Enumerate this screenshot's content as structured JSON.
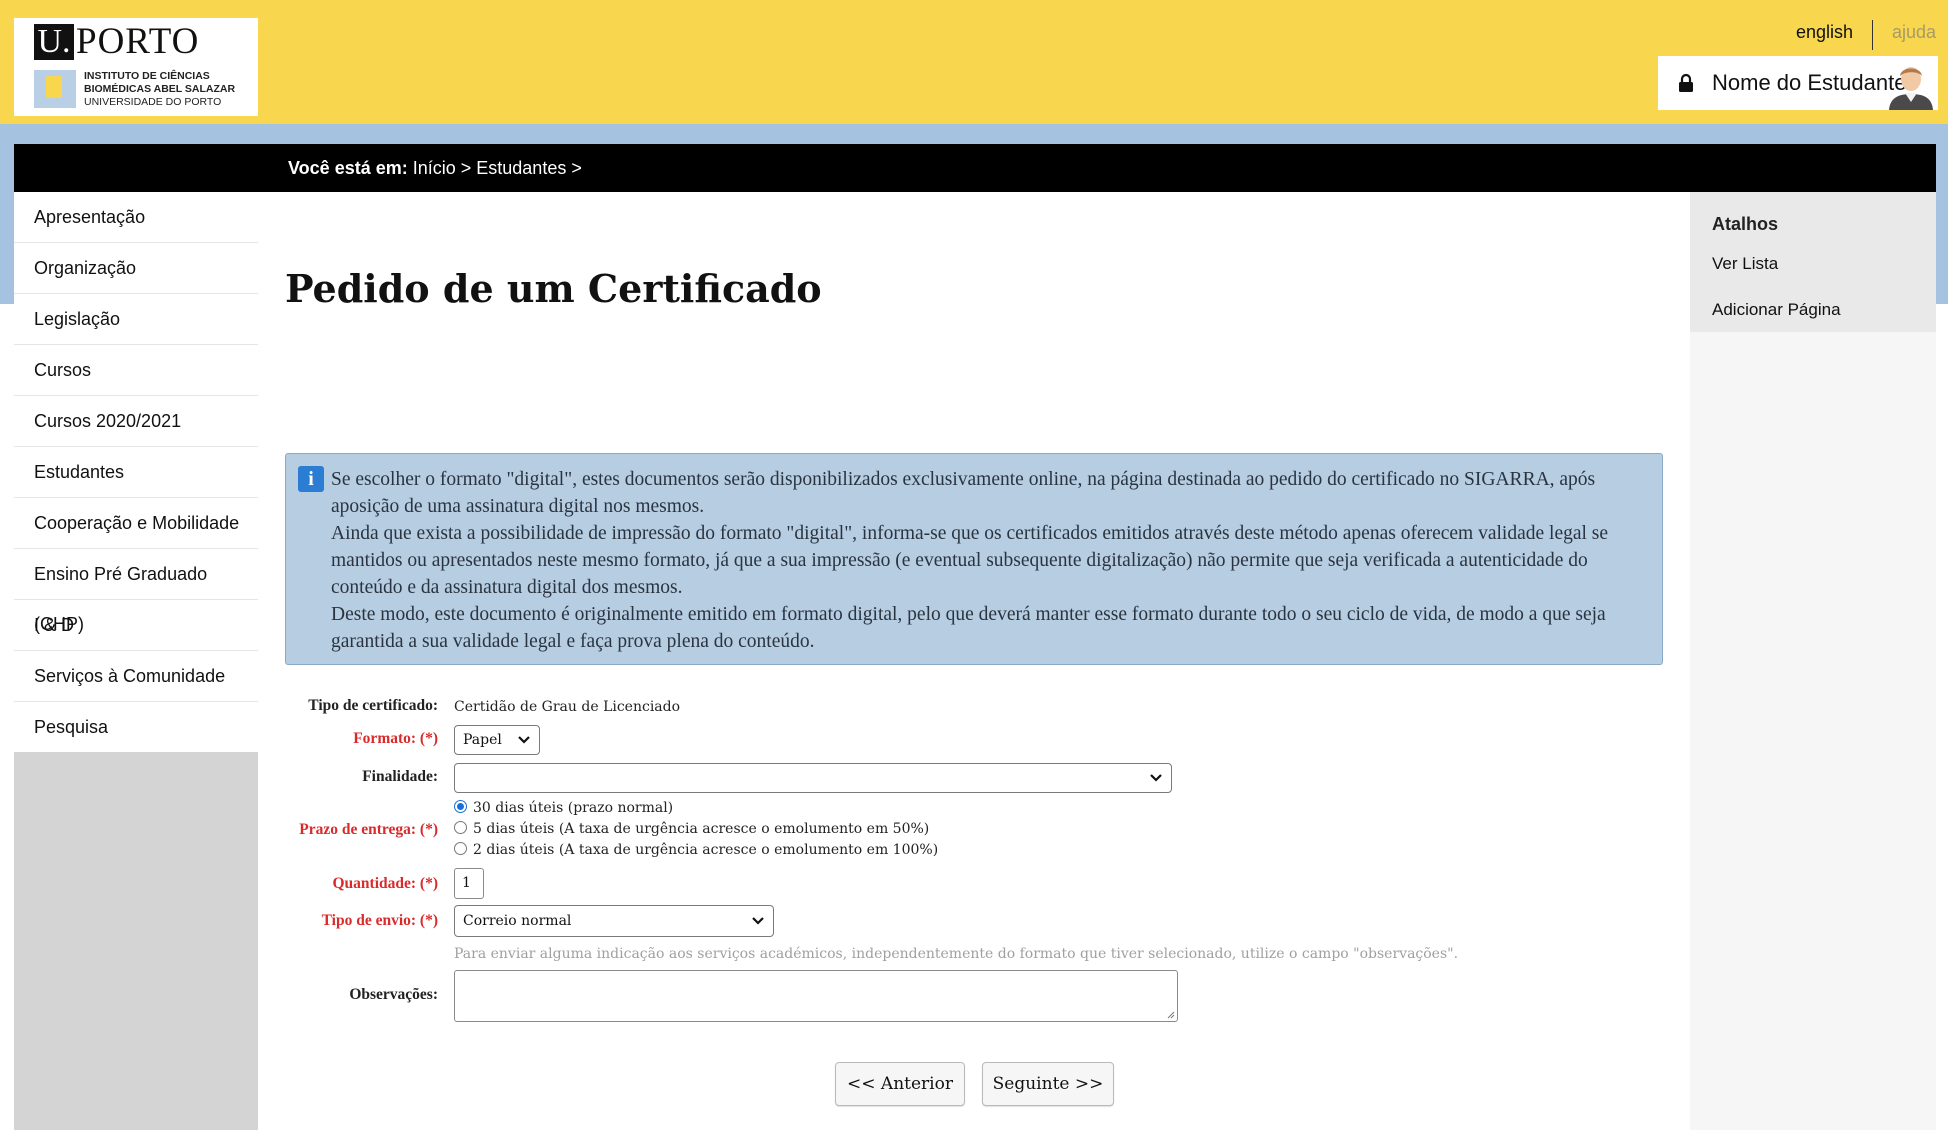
{
  "header": {
    "logo": {
      "u": "U.",
      "name": "PORTO",
      "inst_line1": "INSTITUTO DE CIÊNCIAS",
      "inst_line2": "BIOMÉDICAS ABEL SALAZAR",
      "inst_line3": "UNIVERSIDADE DO PORTO"
    },
    "lang_link": "english",
    "help_link": "ajuda",
    "user_name": "Nome do Estudante"
  },
  "breadcrumb": {
    "prefix": "Você está em:",
    "path": " Início > Estudantes >"
  },
  "sidebar": {
    "items": [
      {
        "label": "Apresentação"
      },
      {
        "label": "Organização"
      },
      {
        "label": "Legislação"
      },
      {
        "label": "Cursos"
      },
      {
        "label": "Cursos 2020/2021"
      },
      {
        "label": "Estudantes"
      },
      {
        "label": "Cooperação e Mobilidade"
      },
      {
        "label": "Ensino Pré Graduado (CHP)"
      },
      {
        "label": "I & D"
      },
      {
        "label": "Serviços à Comunidade"
      },
      {
        "label": "Pesquisa"
      }
    ]
  },
  "shortcuts": {
    "title": "Atalhos",
    "items": [
      "Ver Lista",
      "Adicionar Página"
    ]
  },
  "main": {
    "title": "Pedido de um Certificado",
    "info": {
      "p1": "Se escolher o formato \"digital\", estes documentos serão disponibilizados exclusivamente online, na página destinada ao pedido do certificado no SIGARRA, após aposição de uma assinatura digital nos mesmos.",
      "p2": "Ainda que exista a possibilidade de impressão do formato \"digital\", informa-se que os certificados emitidos através deste método apenas oferecem validade legal se mantidos ou apresentados neste mesmo formato, já que a sua impressão (e eventual subsequente digitalização) não permite que seja verificada a autenticidade do conteúdo e da assinatura digital dos mesmos.",
      "p3": "Deste modo, este documento é originalmente emitido em formato digital, pelo que deverá manter esse formato durante todo o seu ciclo de vida, de modo a que seja garantida a sua validade legal e faça prova plena do conteúdo."
    },
    "form": {
      "tipo_certificado": {
        "label": "Tipo de certificado:",
        "value": "Certidão de Grau de Licenciado"
      },
      "formato": {
        "label": "Formato: (*)",
        "value": "Papel"
      },
      "finalidade": {
        "label": "Finalidade:",
        "value": ""
      },
      "prazo": {
        "label": "Prazo de entrega: (*)",
        "options": [
          "30 dias úteis (prazo normal)",
          "5 dias úteis (A taxa de urgência acresce o emolumento em 50%)",
          "2 dias úteis (A taxa de urgência acresce o emolumento em 100%)"
        ],
        "selected": 0
      },
      "quantidade": {
        "label": "Quantidade: (*)",
        "value": "1"
      },
      "tipo_envio": {
        "label": "Tipo de envio: (*)",
        "value": "Correio normal"
      },
      "hint": "Para enviar alguma indicação aos serviços académicos, independentemente do formato que tiver selecionado, utilize o campo \"observações\".",
      "observacoes": {
        "label": "Observações:",
        "value": ""
      }
    },
    "buttons": {
      "prev": "<< Anterior",
      "next": "Seguinte >>"
    }
  },
  "colors": {
    "header_bg": "#f8d64e",
    "band_blue": "#a5c2e0",
    "info_bg": "#b6cde2",
    "required_red": "#d92b2b"
  }
}
